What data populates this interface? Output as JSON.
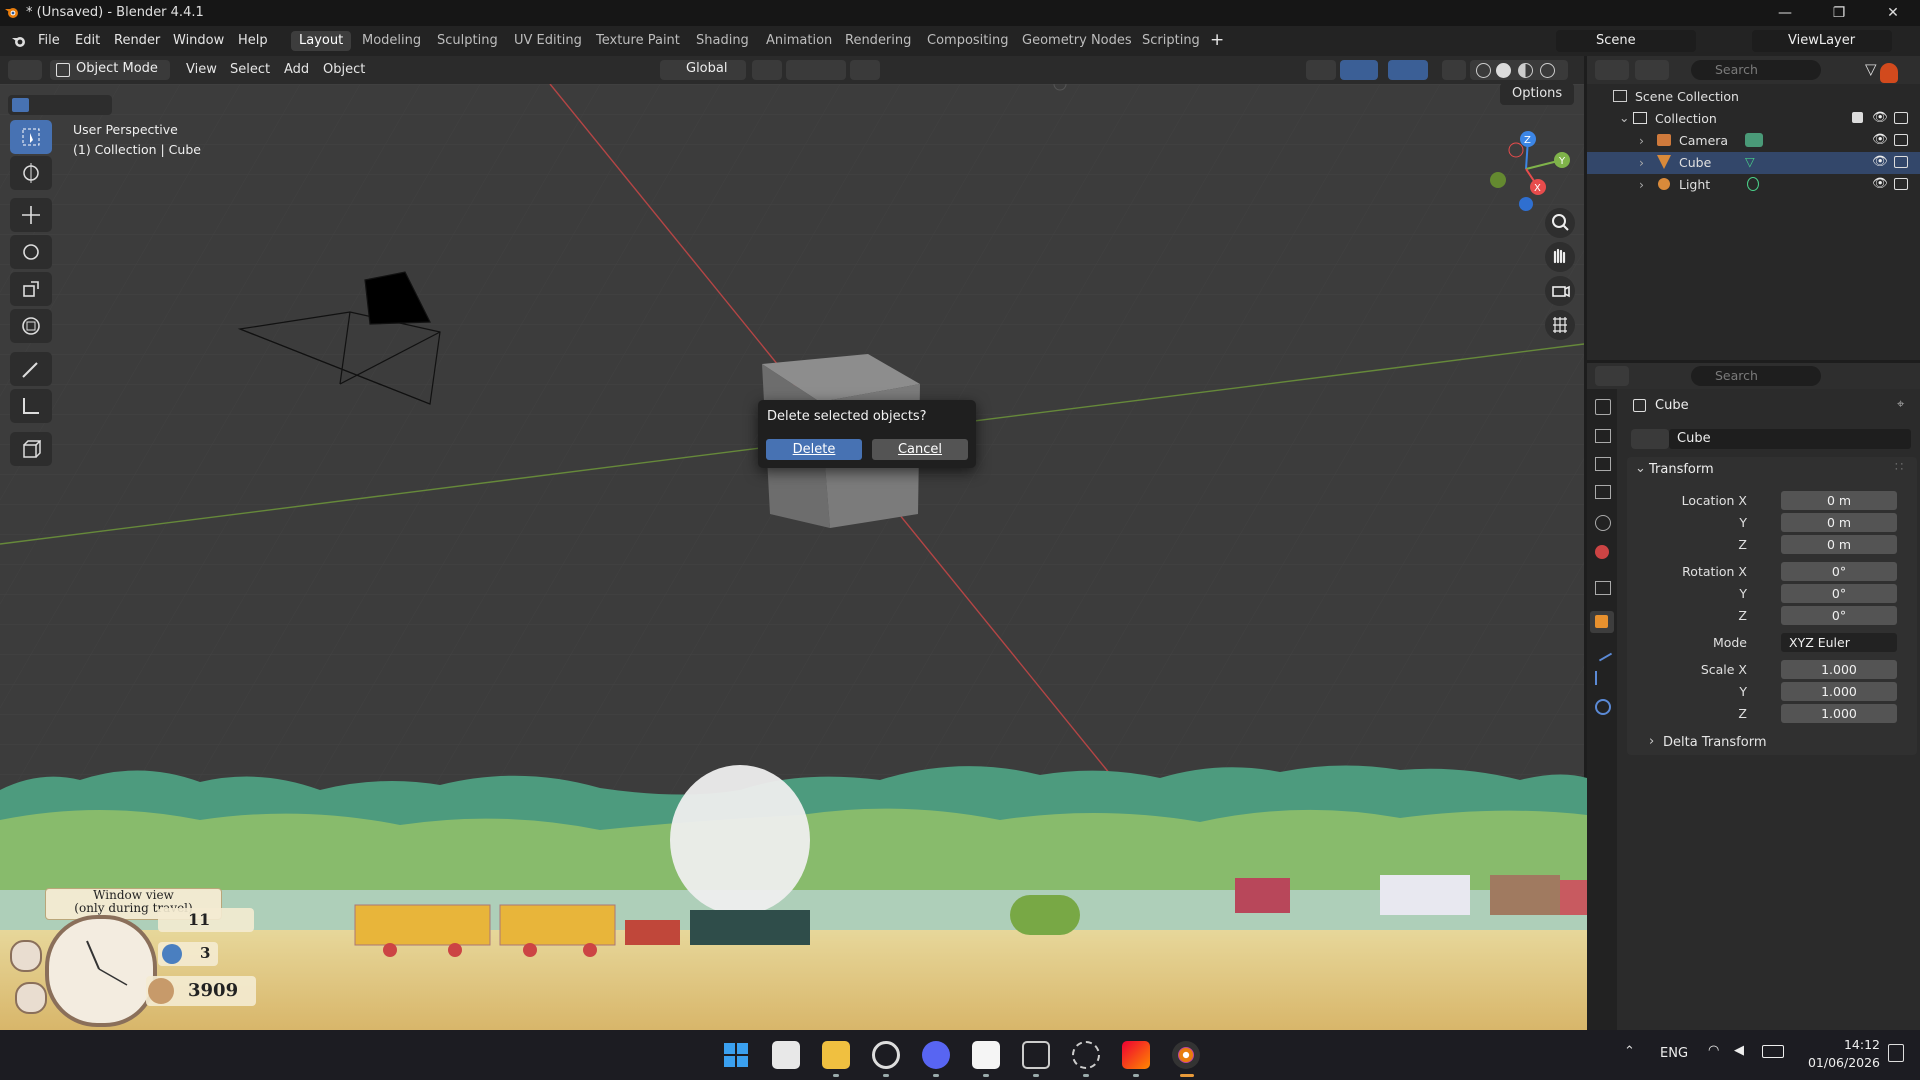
{
  "window": {
    "title": "* (Unsaved) - Blender 4.4.1"
  },
  "menus": [
    "File",
    "Edit",
    "Render",
    "Window",
    "Help"
  ],
  "workspaces": [
    "Layout",
    "Modeling",
    "Sculpting",
    "UV Editing",
    "Texture Paint",
    "Shading",
    "Animation",
    "Rendering",
    "Compositing",
    "Geometry Nodes",
    "Scripting"
  ],
  "active_workspace": "Layout",
  "scene": {
    "name": "Scene",
    "view_layer": "ViewLayer"
  },
  "header": {
    "mode": "Object Mode",
    "menus": [
      "View",
      "Select",
      "Add",
      "Object"
    ],
    "orientation": "Global",
    "options": "Options"
  },
  "viewport": {
    "perspective": "User Perspective",
    "context": "(1) Collection | Cube",
    "gizmo": {
      "x": "X",
      "y": "Y",
      "z": "Z"
    }
  },
  "dialog": {
    "message": "Delete selected objects?",
    "confirm": "Delete",
    "cancel": "Cancel"
  },
  "outliner": {
    "search_placeholder": "Search",
    "root": "Scene Collection",
    "collection": "Collection",
    "items": [
      {
        "name": "Camera"
      },
      {
        "name": "Cube"
      },
      {
        "name": "Light"
      }
    ]
  },
  "properties": {
    "search_placeholder": "Search",
    "object_name": "Cube",
    "object_field": "Cube",
    "transform_title": "Transform",
    "location": {
      "label": "Location X",
      "x": "0 m",
      "y": "0 m",
      "z": "0 m"
    },
    "rotation": {
      "label": "Rotation X",
      "x": "0°",
      "y": "0°",
      "z": "0°"
    },
    "mode": {
      "label": "Mode",
      "value": "XYZ Euler"
    },
    "scale": {
      "label": "Scale X",
      "x": "1.000",
      "y": "1.000",
      "z": "1.000"
    },
    "axis_y": "Y",
    "axis_z": "Z",
    "delta": "Delta Transform"
  },
  "game": {
    "window_view_line1": "Window view",
    "window_view_line2": "(only during travel)",
    "count_small": "11",
    "count_passengers": "3",
    "money": "3909"
  },
  "taskbar": {
    "lang": "ENG",
    "time": "14:12",
    "date": "01/06/2026"
  },
  "colors": {
    "accent": "#4772b3",
    "axis_x": "#e74c4c",
    "axis_y": "#7fb34a",
    "axis_z": "#3c86e6"
  }
}
